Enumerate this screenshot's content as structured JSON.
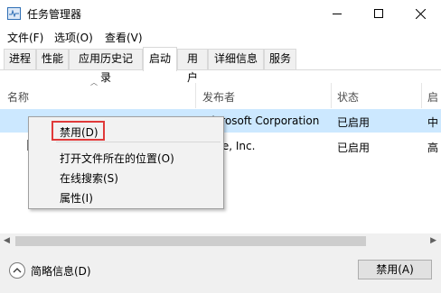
{
  "window": {
    "title": "任务管理器",
    "app_icon": "task-manager-icon",
    "controls": {
      "minimize": "minimize-icon",
      "maximize": "maximize-icon",
      "close": "close-icon"
    }
  },
  "menu": [
    "文件(F)",
    "选项(O)",
    "查看(V)"
  ],
  "tabs": [
    "进程",
    "性能",
    "应用历史记录",
    "启动",
    "用户",
    "详细信息",
    "服务"
  ],
  "active_tab": "启动",
  "columns": {
    "name": "名称",
    "publisher": "发布者",
    "status": "状态",
    "impact": "启"
  },
  "rows": [
    {
      "name": "",
      "publisher": "Microsoft Corporation",
      "status": "已启用",
      "impact": "中",
      "selected": true
    },
    {
      "name": "",
      "publisher": "ware, Inc.",
      "status": "已启用",
      "impact": "高",
      "selected": false
    }
  ],
  "context_menu": {
    "disable": "禁用(D)",
    "open_location": "打开文件所在的位置(O)",
    "search_online": "在线搜索(S)",
    "properties": "属性(I)"
  },
  "footer": {
    "summary_label": "简略信息(D)",
    "disable_button": "禁用(A)"
  },
  "colors": {
    "selection": "#cce8ff",
    "highlight_border": "#e03a3a"
  }
}
